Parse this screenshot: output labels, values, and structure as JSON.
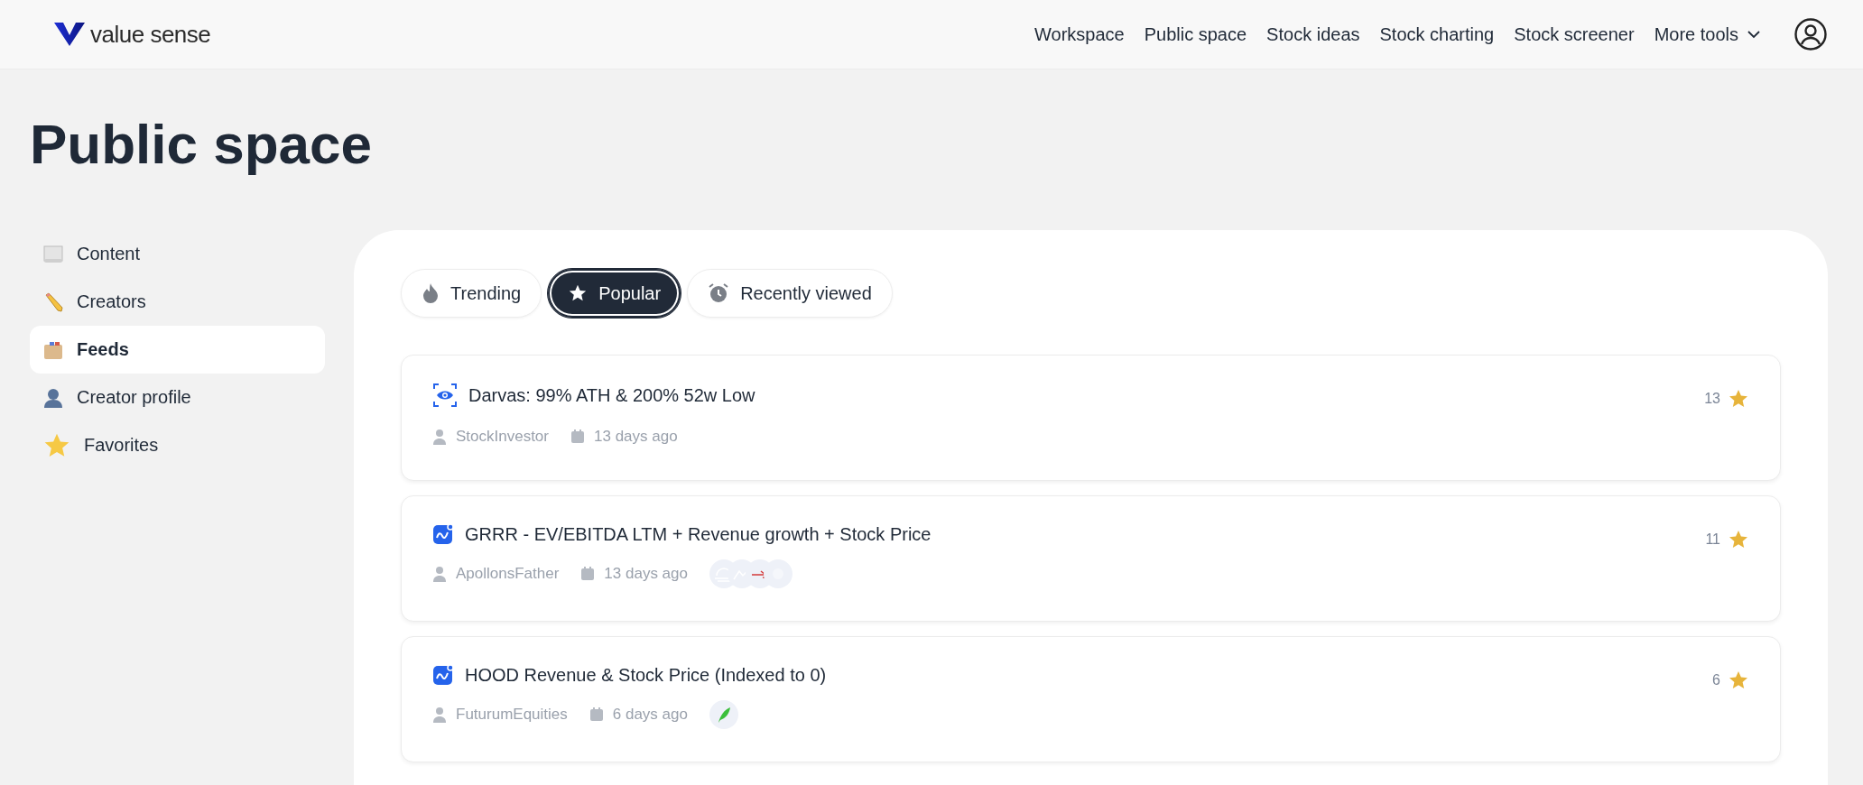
{
  "header": {
    "logo_text": "value sense",
    "nav": [
      {
        "label": "Workspace",
        "kind": "link"
      },
      {
        "label": "Public space",
        "kind": "link"
      },
      {
        "label": "Stock ideas",
        "kind": "link"
      },
      {
        "label": "Stock charting",
        "kind": "link"
      },
      {
        "label": "Stock screener",
        "kind": "link"
      },
      {
        "label": "More tools",
        "kind": "dropdown"
      }
    ]
  },
  "page_title": "Public space",
  "sidebar": {
    "items": [
      {
        "label": "Content",
        "kind": "scroll",
        "selected": false
      },
      {
        "label": "Creators",
        "kind": "pencil",
        "selected": false
      },
      {
        "label": "Feeds",
        "kind": "box",
        "selected": true
      },
      {
        "label": "Creator profile",
        "kind": "person",
        "selected": false
      },
      {
        "label": "Favorites",
        "kind": "star",
        "selected": false
      }
    ]
  },
  "tabs": [
    {
      "label": "Trending",
      "kind": "flame",
      "selected": false
    },
    {
      "label": "Popular",
      "kind": "star",
      "selected": true
    },
    {
      "label": "Recently viewed",
      "kind": "clock",
      "selected": false
    }
  ],
  "feed": [
    {
      "kind": "screener",
      "title": "Darvas: 99% ATH & 200% 52w Low",
      "author": "StockInvestor",
      "date": "13 days ago",
      "favorites": "13"
    },
    {
      "kind": "chart",
      "title": "GRRR - EV/EBITDA LTM + Revenue growth + Stock Price",
      "author": "ApollonsFather",
      "date": "13 days ago",
      "logos": [
        {
          "kind": "sun"
        },
        {
          "kind": "mountain"
        },
        {
          "kind": "arrow"
        },
        {
          "kind": "plain"
        }
      ],
      "favorites": "11"
    },
    {
      "kind": "chart",
      "title": "HOOD Revenue & Stock Price (Indexed to 0)",
      "author": "FuturumEquities",
      "date": "6 days ago",
      "logos": [
        {
          "kind": "feather"
        }
      ],
      "favorites": "6"
    }
  ]
}
